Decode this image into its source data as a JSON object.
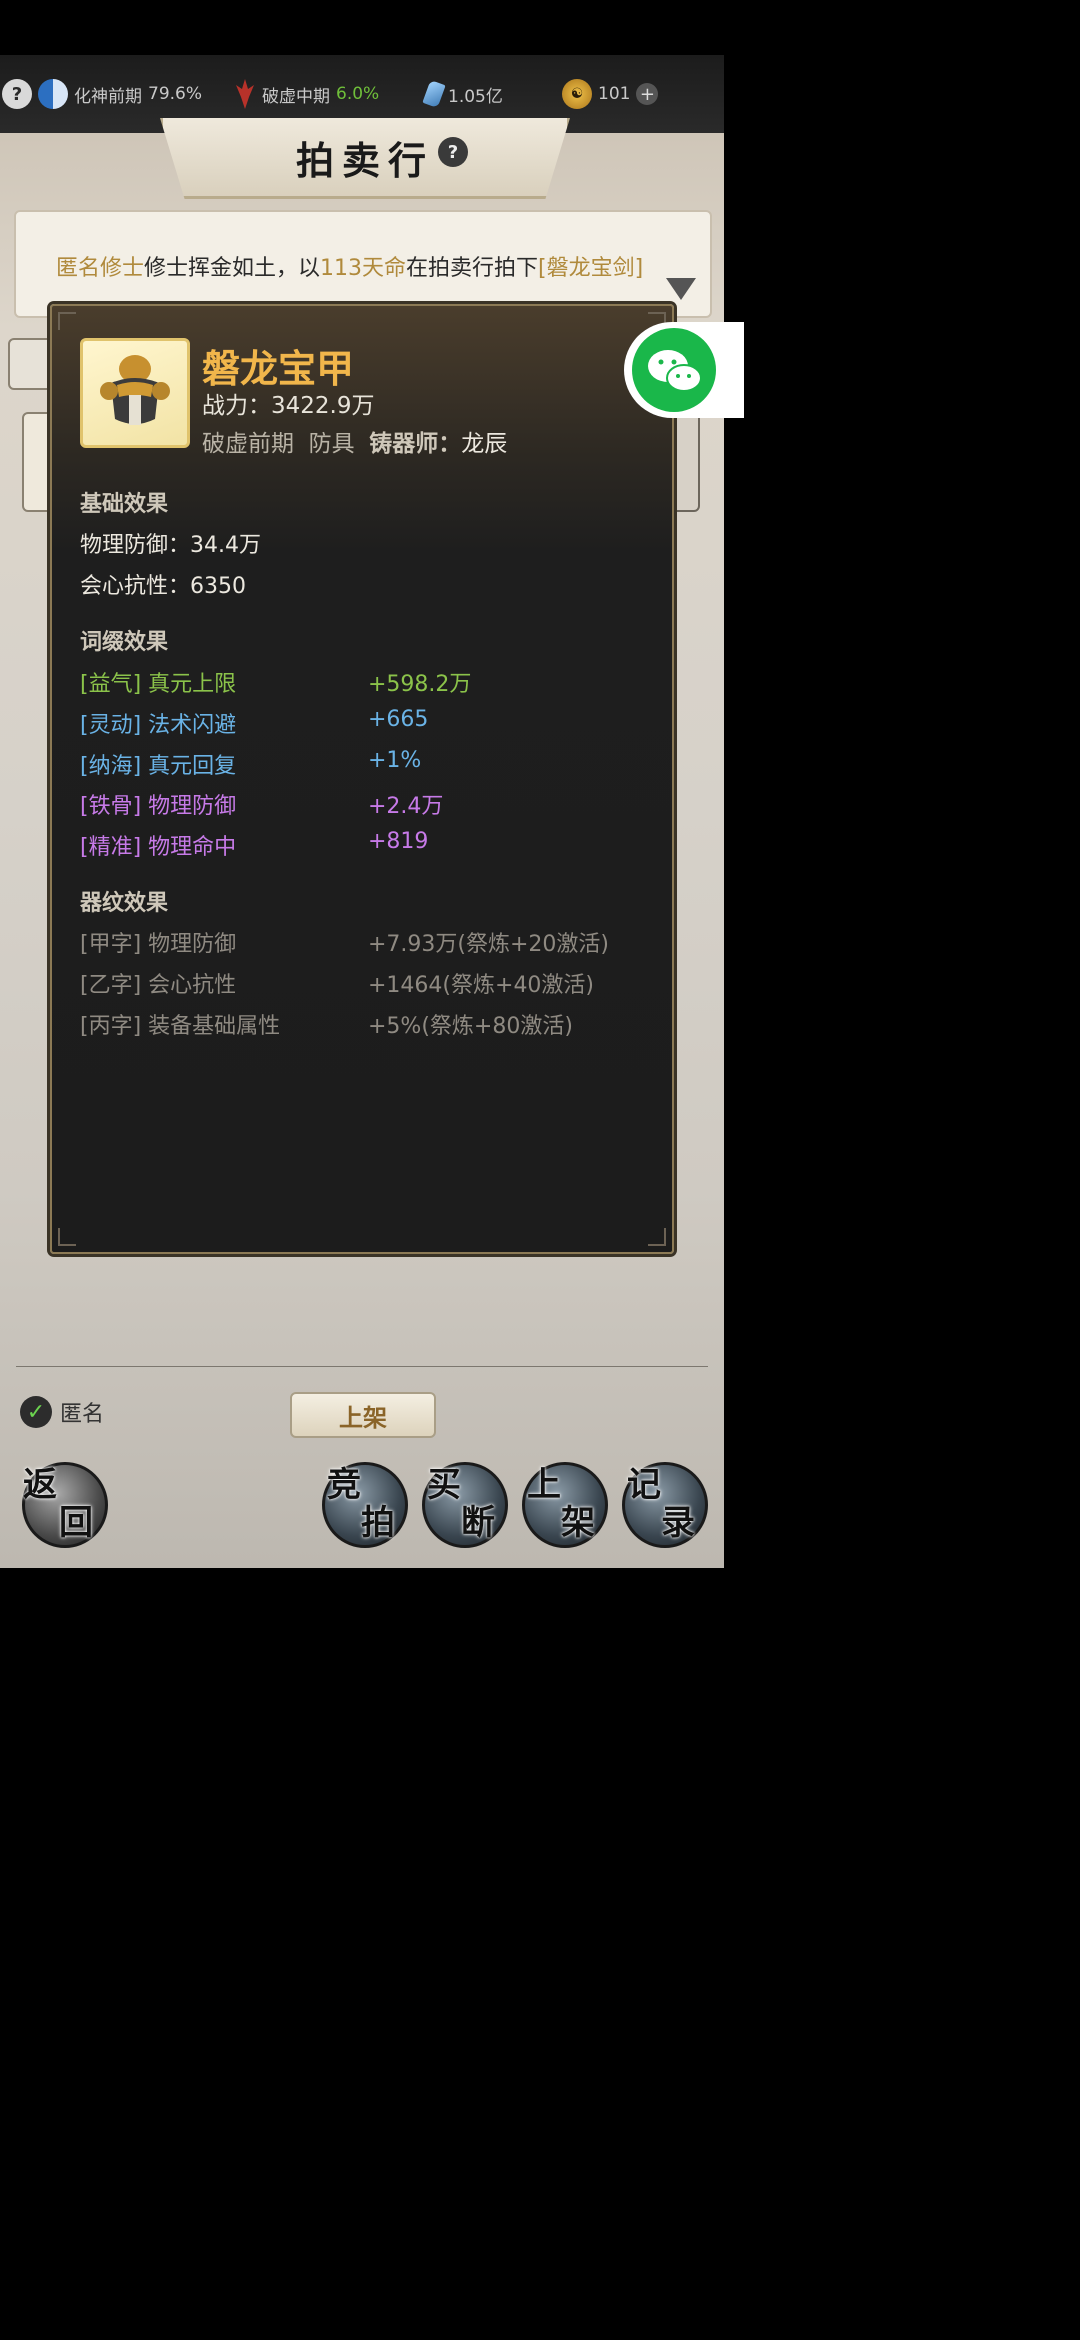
{
  "topbar": {
    "realm_label": "化神前期",
    "realm_percent": "79.6%",
    "realm2_label": "破虚中期",
    "realm2_percent": "6.0%",
    "spirit_stones": "1.05亿",
    "coins": "101",
    "icons": [
      "help-icon",
      "yinyang-icon",
      "flame-icon",
      "crystal-icon",
      "coin-icon",
      "plus-icon"
    ]
  },
  "title": {
    "text": "拍卖行"
  },
  "notice": {
    "anon": "匿名修士",
    "text1": "修士挥金如土，以",
    "price": "113天命",
    "text2": "在拍卖行拍下",
    "item": "[磐龙宝剑]"
  },
  "item": {
    "name": "磐龙宝甲",
    "power_label": "战力：",
    "power_value": "3422.9万",
    "realm": "破虚前期",
    "type": "防具",
    "smith_label": "铸器师：",
    "smith_name": "龙辰"
  },
  "base_effects": {
    "title": "基础效果",
    "rows": [
      {
        "label": "物理防御：",
        "value": "34.4万"
      },
      {
        "label": "会心抗性：",
        "value": "6350"
      }
    ]
  },
  "affix_effects": {
    "title": "词缀效果",
    "rows": [
      {
        "tag": "[益气]",
        "stat": "真元上限",
        "value": "+598.2万",
        "color": "#8bc34a"
      },
      {
        "tag": "[灵动]",
        "stat": "法术闪避",
        "value": "+665",
        "color": "#6ab3e6"
      },
      {
        "tag": "[纳海]",
        "stat": "真元回复",
        "value": "+1%",
        "color": "#6ab3e6"
      },
      {
        "tag": "[铁骨]",
        "stat": "物理防御",
        "value": "+2.4万",
        "color": "#c77ae8"
      },
      {
        "tag": "[精准]",
        "stat": "物理命中",
        "value": "+819",
        "color": "#c77ae8"
      }
    ]
  },
  "pattern_effects": {
    "title": "器纹效果",
    "rows": [
      {
        "tag": "[甲字]",
        "stat": "物理防御",
        "value": "+7.93万(祭炼+20激活)"
      },
      {
        "tag": "[乙字]",
        "stat": "会心抗性",
        "value": "+1464(祭炼+40激活)"
      },
      {
        "tag": "[丙字]",
        "stat": "装备基础属性",
        "value": "+5%(祭炼+80激活)"
      }
    ]
  },
  "bottom": {
    "anon_label": "匿名",
    "list_button": "上架",
    "back": [
      "返",
      "回"
    ],
    "auction": [
      "竞",
      "拍"
    ],
    "buyout": [
      "买",
      "断"
    ],
    "shelve": [
      "上",
      "架"
    ],
    "records": [
      "记",
      "录"
    ]
  }
}
